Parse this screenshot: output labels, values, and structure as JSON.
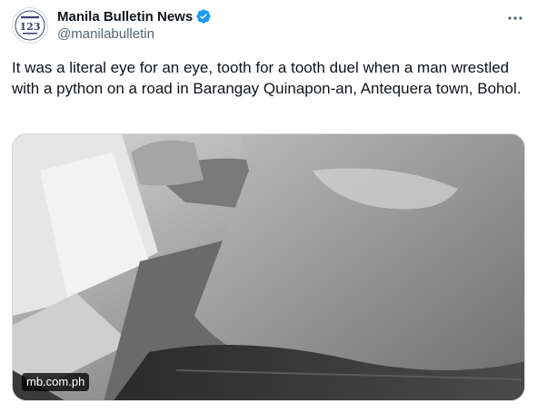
{
  "author": {
    "name": "Manila Bulletin News",
    "handle": "@manilabulletin",
    "verified": true,
    "avatar_icon": "manila-bulletin-123-years-logo"
  },
  "more_icon": "more-dots-icon",
  "tweet": {
    "text": "It was a literal eye for an eye, tooth for a tooth duel when a man wrestled with a python on a road in Barangay Quinapon-an, Antequera town, Bohol."
  },
  "media": {
    "type": "photo",
    "style": "black-and-white",
    "source_label": "mb.com.ph"
  },
  "colors": {
    "verified": "#1d9bf0",
    "handle": "#536471",
    "text": "#0f1419",
    "border": "#cfd9de"
  }
}
